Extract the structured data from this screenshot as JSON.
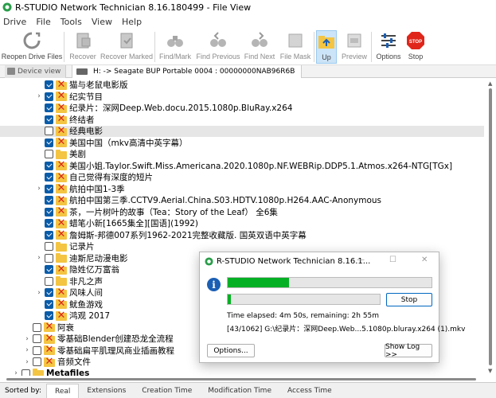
{
  "window": {
    "title": "R-STUDIO Network Technician 8.16.180499 - File View"
  },
  "menu": [
    "Drive",
    "File",
    "Tools",
    "View",
    "Help"
  ],
  "toolbar": {
    "buttons": [
      {
        "label": "Reopen Drive Files",
        "icon": "reopen-icon",
        "enabled": true
      },
      {
        "label": "Recover",
        "icon": "recover-icon",
        "enabled": false
      },
      {
        "label": "Recover Marked",
        "icon": "recover-marked-icon",
        "enabled": false
      },
      {
        "label": "Find/Mark",
        "icon": "binoculars-icon",
        "enabled": false
      },
      {
        "label": "Find Previous",
        "icon": "find-previous-icon",
        "enabled": false
      },
      {
        "label": "Find Next",
        "icon": "find-next-icon",
        "enabled": false
      },
      {
        "label": "File Mask",
        "icon": "file-mask-icon",
        "enabled": false
      },
      {
        "label": "Up",
        "icon": "folder-up-icon",
        "enabled": true
      },
      {
        "label": "Preview",
        "icon": "preview-icon",
        "enabled": false
      },
      {
        "label": "Options",
        "icon": "options-icon",
        "enabled": true
      },
      {
        "label": "Stop",
        "icon": "stop-icon",
        "enabled": true
      }
    ],
    "stop_sign_text": "STOP"
  },
  "tabs": {
    "device_view": "Device view",
    "path": "H: -> Seagate BUP Portable 0004 : 00000000NAB96R6B"
  },
  "tree": [
    {
      "name": "猫与老鼠电影版",
      "checked": true,
      "expander": false,
      "icon": "x",
      "level": 2
    },
    {
      "name": "纪实节目",
      "checked": true,
      "expander": true,
      "icon": "x",
      "level": 2
    },
    {
      "name": "纪录片：深网Deep.Web.docu.2015.1080p.BluRay.x264",
      "checked": true,
      "expander": false,
      "icon": "x",
      "level": 2
    },
    {
      "name": "终结者",
      "checked": true,
      "expander": false,
      "icon": "x",
      "level": 2
    },
    {
      "name": "经典电影",
      "checked": false,
      "expander": false,
      "icon": "x",
      "level": 2,
      "selected": true
    },
    {
      "name": "美国中国（mkv高清中英字幕）",
      "checked": true,
      "expander": false,
      "icon": "x",
      "level": 2
    },
    {
      "name": "美剧",
      "checked": false,
      "expander": false,
      "icon": "folder",
      "level": 2
    },
    {
      "name": "美国小姐.Taylor.Swift.Miss.Americana.2020.1080p.NF.WEBRip.DDP5.1.Atmos.x264-NTG[TGx]",
      "checked": true,
      "expander": false,
      "icon": "x",
      "level": 2
    },
    {
      "name": "自己觉得有深度的短片",
      "checked": true,
      "expander": false,
      "icon": "x",
      "level": 2
    },
    {
      "name": "航拍中国1-3季",
      "checked": true,
      "expander": true,
      "icon": "x",
      "level": 2
    },
    {
      "name": "航拍中国第三季.CCTV9.Aerial.China.S03.HDTV.1080p.H264.AAC-Anonymous",
      "checked": true,
      "expander": false,
      "icon": "x",
      "level": 2
    },
    {
      "name": "茶，一片树叶的故事（Tea：Story of the Leaf） 全6集",
      "checked": true,
      "expander": false,
      "icon": "x",
      "level": 2
    },
    {
      "name": "蜡笔小新[1665集全][国语](1992)",
      "checked": true,
      "expander": false,
      "icon": "x",
      "level": 2
    },
    {
      "name": "詹姆斯-邦德007系列1962-2021完整收藏版. 国英双语中英字幕",
      "checked": true,
      "expander": false,
      "icon": "x",
      "level": 2
    },
    {
      "name": "记录片",
      "checked": false,
      "expander": false,
      "icon": "folder",
      "level": 2
    },
    {
      "name": "迪斯尼动漫电影",
      "checked": false,
      "expander": true,
      "icon": "folder",
      "level": 2
    },
    {
      "name": "隐姓亿万富翁",
      "checked": true,
      "expander": false,
      "icon": "x",
      "level": 2
    },
    {
      "name": "非凡之声",
      "checked": false,
      "expander": false,
      "icon": "folder",
      "level": 2
    },
    {
      "name": "风味人间",
      "checked": true,
      "expander": true,
      "icon": "x",
      "level": 2
    },
    {
      "name": "鱿鱼游戏",
      "checked": true,
      "expander": false,
      "icon": "x",
      "level": 2
    },
    {
      "name": "鸿观 2017",
      "checked": true,
      "expander": false,
      "icon": "x",
      "level": 2
    },
    {
      "name": "阿衰",
      "checked": false,
      "expander": false,
      "icon": "x",
      "level": 1
    },
    {
      "name": "零基础Blender创建恐龙全流程",
      "checked": false,
      "expander": true,
      "icon": "x",
      "level": 1
    },
    {
      "name": "零基础扁平肌理风商业插画教程",
      "checked": false,
      "expander": true,
      "icon": "x",
      "level": 1
    },
    {
      "name": "音频文件",
      "checked": false,
      "expander": true,
      "icon": "x",
      "level": 1
    },
    {
      "name": "Metafiles",
      "checked": false,
      "expander": true,
      "icon": "folder",
      "level": 0,
      "bold": true
    }
  ],
  "statusbar": {
    "sorted_by": "Sorted by:",
    "tabs": [
      "Real",
      "Extensions",
      "Creation Time",
      "Modification Time",
      "Access Time"
    ],
    "active_tab": "Real"
  },
  "dialog": {
    "title": "R-STUDIO Network Technician 8.16.1...",
    "progress_overall": 0.3,
    "progress_file": 0.02,
    "stop_label": "Stop",
    "time_text": "Time elapsed: 4m 50s, remaining: 2h 55m",
    "file_text": "[43/1062] G:\\纪录片：深网Deep.Web...5.1080p.bluray.x264 (1).mkv",
    "options_label": "Options...",
    "show_log_label": "Show Log >>"
  },
  "colors": {
    "progress_fill": "#06b025",
    "checkbox_blue": "#0a5ca8",
    "x_red": "#d9281b",
    "folder_yellow": "#f4c542",
    "info_blue": "#1b5fb4",
    "stop_red": "#e0261a"
  }
}
